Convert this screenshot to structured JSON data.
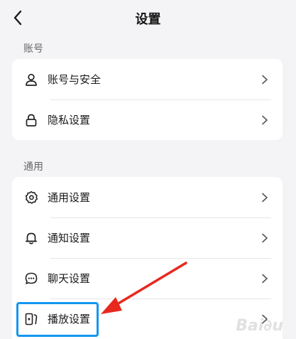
{
  "header": {
    "title": "设置"
  },
  "sections": [
    {
      "label": "账号",
      "items": [
        {
          "label": "账号与安全",
          "icon": "user-icon"
        },
        {
          "label": "隐私设置",
          "icon": "lock-icon"
        }
      ]
    },
    {
      "label": "通用",
      "items": [
        {
          "label": "通用设置",
          "icon": "gear-icon"
        },
        {
          "label": "通知设置",
          "icon": "bell-icon"
        },
        {
          "label": "聊天设置",
          "icon": "chat-icon"
        },
        {
          "label": "播放设置",
          "icon": "play-device-icon"
        }
      ]
    }
  ],
  "colors": {
    "highlight": "#1296f0",
    "arrow": "#e8281e",
    "background": "#f4f4f6"
  }
}
